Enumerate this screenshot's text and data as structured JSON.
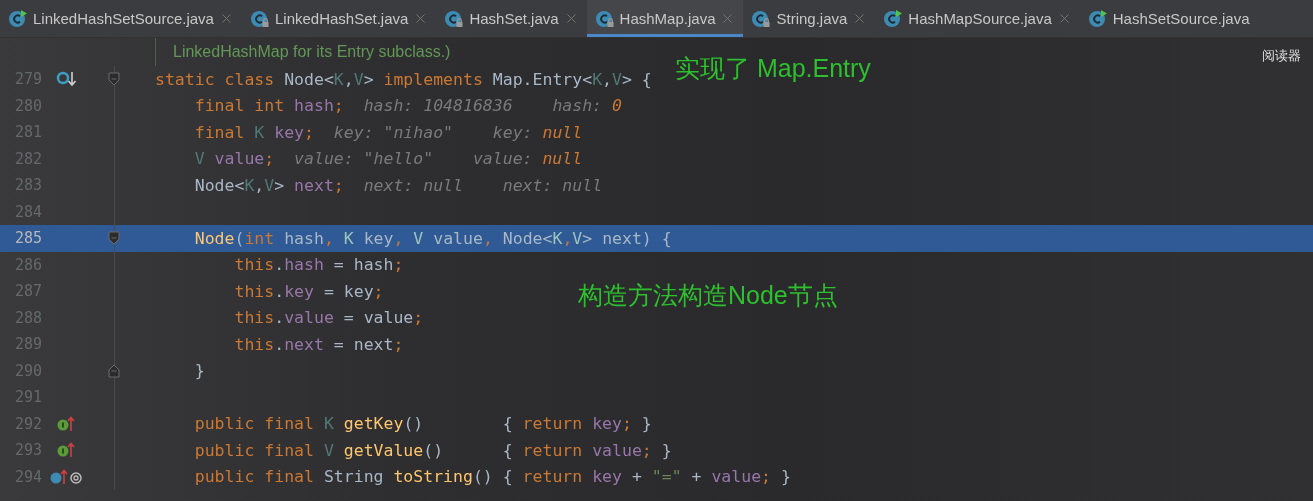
{
  "tabs": [
    {
      "label": "LinkedHashSetSource.java",
      "kind": "source",
      "selected": false,
      "closable": true
    },
    {
      "label": "LinkedHashSet.java",
      "kind": "locked",
      "selected": false,
      "closable": true
    },
    {
      "label": "HashSet.java",
      "kind": "locked",
      "selected": false,
      "closable": true
    },
    {
      "label": "HashMap.java",
      "kind": "locked",
      "selected": true,
      "closable": true
    },
    {
      "label": "String.java",
      "kind": "locked",
      "selected": false,
      "closable": true
    },
    {
      "label": "HashMapSource.java",
      "kind": "source",
      "selected": false,
      "closable": true
    },
    {
      "label": "HashSetSource.java",
      "kind": "source",
      "selected": false,
      "closable": false
    }
  ],
  "doc_comment": "LinkedHashMap for its Entry subclass.)",
  "reader_mode": "阅读器",
  "annotations": [
    {
      "text": "实现了 Map.Entry"
    },
    {
      "text": "构造方法构造Node节点"
    }
  ],
  "lines": [
    {
      "number": "279",
      "kind": "implemented",
      "fold_start": true,
      "fold_end": false,
      "selected": false,
      "tokens": [
        {
          "kind": "kw",
          "text": "static class "
        },
        {
          "kind": "plain",
          "text": "Node<"
        },
        {
          "kind": "type",
          "text": "K"
        },
        {
          "kind": "plain",
          "text": ","
        },
        {
          "kind": "type",
          "text": "V"
        },
        {
          "kind": "plain",
          "text": "> "
        },
        {
          "kind": "kw",
          "text": "implements "
        },
        {
          "kind": "plain",
          "text": "Map.Entry<"
        },
        {
          "kind": "type",
          "text": "K"
        },
        {
          "kind": "plain",
          "text": ","
        },
        {
          "kind": "type",
          "text": "V"
        },
        {
          "kind": "plain",
          "text": "> {"
        }
      ]
    },
    {
      "number": "280",
      "kind": "plain",
      "fold_start": false,
      "fold_end": false,
      "selected": false,
      "tokens": [
        {
          "kind": "kw",
          "text": "    final int "
        },
        {
          "kind": "field",
          "text": "hash"
        },
        {
          "kind": "kw",
          "text": ";"
        },
        {
          "kind": "hint",
          "text": "  hash: 104816836    hash: "
        },
        {
          "kind": "hintvalue",
          "text": "0"
        }
      ]
    },
    {
      "number": "281",
      "kind": "plain",
      "fold_start": false,
      "fold_end": false,
      "selected": false,
      "tokens": [
        {
          "kind": "kw",
          "text": "    final "
        },
        {
          "kind": "type",
          "text": "K "
        },
        {
          "kind": "field",
          "text": "key"
        },
        {
          "kind": "kw",
          "text": ";"
        },
        {
          "kind": "hint",
          "text": "  key: \"nihao\"    key: "
        },
        {
          "kind": "hintvalue",
          "text": "null"
        }
      ]
    },
    {
      "number": "282",
      "kind": "plain",
      "fold_start": false,
      "fold_end": false,
      "selected": false,
      "tokens": [
        {
          "kind": "type",
          "text": "    V "
        },
        {
          "kind": "field",
          "text": "value"
        },
        {
          "kind": "kw",
          "text": ";"
        },
        {
          "kind": "hint",
          "text": "  value: \"hello\"    value: "
        },
        {
          "kind": "hintvalue",
          "text": "null"
        }
      ]
    },
    {
      "number": "283",
      "kind": "plain",
      "fold_start": false,
      "fold_end": false,
      "selected": false,
      "tokens": [
        {
          "kind": "plain",
          "text": "    Node<"
        },
        {
          "kind": "type",
          "text": "K"
        },
        {
          "kind": "plain",
          "text": ","
        },
        {
          "kind": "type",
          "text": "V"
        },
        {
          "kind": "plain",
          "text": "> "
        },
        {
          "kind": "field",
          "text": "next"
        },
        {
          "kind": "kw",
          "text": ";"
        },
        {
          "kind": "hint",
          "text": "  next: null    next: null"
        }
      ]
    },
    {
      "number": "284",
      "kind": "plain",
      "fold_start": false,
      "fold_end": false,
      "selected": false
    },
    {
      "number": "285",
      "kind": "plain",
      "fold_start": true,
      "fold_end": false,
      "selected": true,
      "tokens": [
        {
          "kind": "method",
          "text": "    Node"
        },
        {
          "kind": "plain",
          "text": "("
        },
        {
          "kind": "kw",
          "text": "int "
        },
        {
          "kind": "plain",
          "text": "hash"
        },
        {
          "kind": "kw",
          "text": ", "
        },
        {
          "kind": "type",
          "text": "K "
        },
        {
          "kind": "plain",
          "text": "key"
        },
        {
          "kind": "kw",
          "text": ", "
        },
        {
          "kind": "type",
          "text": "V "
        },
        {
          "kind": "plain",
          "text": "value"
        },
        {
          "kind": "kw",
          "text": ", "
        },
        {
          "kind": "plain",
          "text": "Node<"
        },
        {
          "kind": "type",
          "text": "K"
        },
        {
          "kind": "kw",
          "text": ","
        },
        {
          "kind": "type",
          "text": "V"
        },
        {
          "kind": "plain",
          "text": "> next) {"
        }
      ]
    },
    {
      "number": "286",
      "kind": "plain",
      "fold_start": false,
      "fold_end": false,
      "selected": false,
      "tokens": [
        {
          "kind": "kw",
          "text": "        this"
        },
        {
          "kind": "plain",
          "text": "."
        },
        {
          "kind": "field",
          "text": "hash"
        },
        {
          "kind": "plain",
          "text": " = hash"
        },
        {
          "kind": "kw",
          "text": ";"
        }
      ]
    },
    {
      "number": "287",
      "kind": "plain",
      "fold_start": false,
      "fold_end": false,
      "selected": false,
      "tokens": [
        {
          "kind": "kw",
          "text": "        this"
        },
        {
          "kind": "plain",
          "text": "."
        },
        {
          "kind": "field",
          "text": "key"
        },
        {
          "kind": "plain",
          "text": " = key"
        },
        {
          "kind": "kw",
          "text": ";"
        }
      ]
    },
    {
      "number": "288",
      "kind": "plain",
      "fold_start": false,
      "fold_end": false,
      "selected": false,
      "tokens": [
        {
          "kind": "kw",
          "text": "        this"
        },
        {
          "kind": "plain",
          "text": "."
        },
        {
          "kind": "field",
          "text": "value"
        },
        {
          "kind": "plain",
          "text": " = value"
        },
        {
          "kind": "kw",
          "text": ";"
        }
      ]
    },
    {
      "number": "289",
      "kind": "plain",
      "fold_start": false,
      "fold_end": false,
      "selected": false,
      "tokens": [
        {
          "kind": "kw",
          "text": "        this"
        },
        {
          "kind": "plain",
          "text": "."
        },
        {
          "kind": "field",
          "text": "next"
        },
        {
          "kind": "plain",
          "text": " = next"
        },
        {
          "kind": "kw",
          "text": ";"
        }
      ]
    },
    {
      "number": "290",
      "kind": "plain",
      "fold_start": false,
      "fold_end": true,
      "selected": false,
      "tokens": [
        {
          "kind": "plain",
          "text": "    }"
        }
      ]
    },
    {
      "number": "291",
      "kind": "plain",
      "fold_start": false,
      "fold_end": false,
      "selected": false
    },
    {
      "number": "292",
      "kind": "implementing",
      "fold_start": false,
      "fold_end": false,
      "selected": false,
      "tokens": [
        {
          "kind": "kw",
          "text": "    public final "
        },
        {
          "kind": "type",
          "text": "K "
        },
        {
          "kind": "method",
          "text": "getKey"
        },
        {
          "kind": "plain",
          "text": "()        { "
        },
        {
          "kind": "kw",
          "text": "return "
        },
        {
          "kind": "field",
          "text": "key"
        },
        {
          "kind": "kw",
          "text": ";"
        },
        {
          "kind": "plain",
          "text": " }"
        }
      ]
    },
    {
      "number": "293",
      "kind": "implementing",
      "fold_start": false,
      "fold_end": false,
      "selected": false,
      "tokens": [
        {
          "kind": "kw",
          "text": "    public final "
        },
        {
          "kind": "type",
          "text": "V "
        },
        {
          "kind": "method",
          "text": "getValue"
        },
        {
          "kind": "plain",
          "text": "()      { "
        },
        {
          "kind": "kw",
          "text": "return "
        },
        {
          "kind": "field",
          "text": "value"
        },
        {
          "kind": "kw",
          "text": ";"
        },
        {
          "kind": "plain",
          "text": " }"
        }
      ]
    },
    {
      "number": "294",
      "kind": "overriding",
      "fold_start": false,
      "fold_end": false,
      "selected": false,
      "tokens": [
        {
          "kind": "kw",
          "text": "    public final "
        },
        {
          "kind": "plain",
          "text": "String "
        },
        {
          "kind": "method",
          "text": "toString"
        },
        {
          "kind": "plain",
          "text": "() { "
        },
        {
          "kind": "kw",
          "text": "return "
        },
        {
          "kind": "field",
          "text": "key"
        },
        {
          "kind": "plain",
          "text": " + "
        },
        {
          "kind": "string",
          "text": "\"=\""
        },
        {
          "kind": "plain",
          "text": " + "
        },
        {
          "kind": "field",
          "text": "value"
        },
        {
          "kind": "kw",
          "text": ";"
        },
        {
          "kind": "plain",
          "text": " }"
        }
      ]
    }
  ]
}
